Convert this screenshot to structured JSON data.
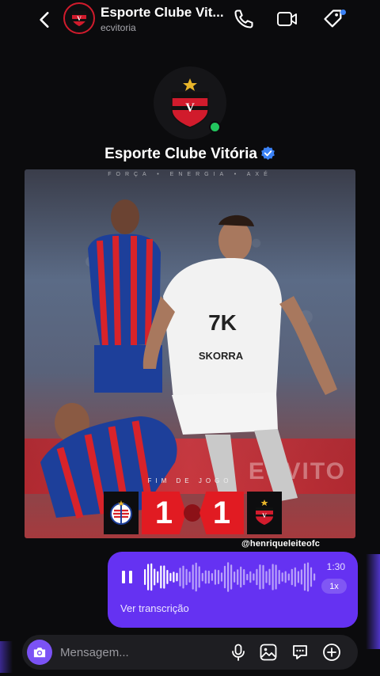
{
  "header": {
    "title": "Esporte Clube Vit...",
    "username": "ecvitoria",
    "icons": [
      "back-arrow-icon",
      "phone-icon",
      "video-icon",
      "tag-icon"
    ]
  },
  "profile": {
    "name": "Esporte Clube Vitória",
    "verified": true,
    "online": true
  },
  "post": {
    "tagline": "FORÇA • ENERGIA • AXÉ",
    "final_label": "FIM DE JOGO",
    "home_score": "1",
    "away_score": "1",
    "banner_text": "ECVITO",
    "watermark": "@henriqueleiteofc"
  },
  "voice_message": {
    "duration": "1:30",
    "speed": "1x",
    "transcript_link": "Ver transcrição",
    "progress": 0.2
  },
  "composer": {
    "placeholder": "Mensagem..."
  },
  "colors": {
    "accent": "#6532f2",
    "camera_button": "#7b52f5",
    "vitoria_red": "#d11b2c",
    "score_red": "#e11b22",
    "online": "#22c55e",
    "verified": "#3b82f6"
  }
}
